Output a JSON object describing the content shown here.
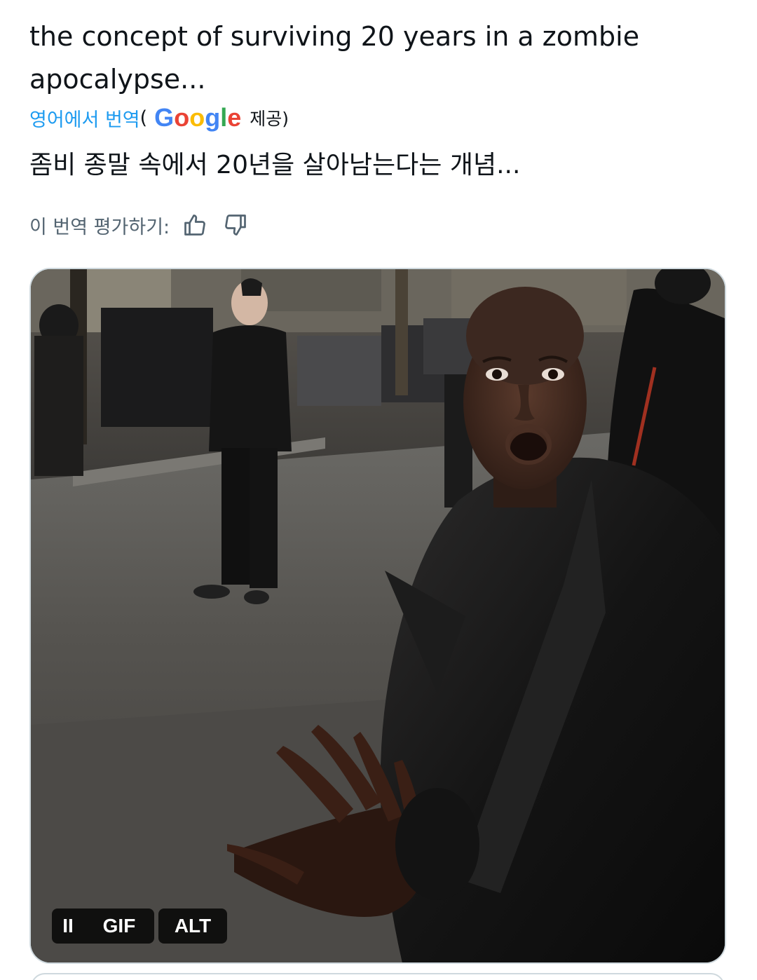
{
  "tweet": {
    "original_text": "the concept of surviving 20 years in a zombie apocalypse...",
    "translation": {
      "source_link": "영어에서 번역",
      "paren_open": "(",
      "google_logo": "Google",
      "provided_by": "제공)",
      "text": "좀비 종말 속에서 20년을 살아남는다는 개념...",
      "rate_label": "이 번역 평가하기:",
      "thumbs_up_icon": "thumbs-up-icon",
      "thumbs_down_icon": "thumbs-down-icon"
    },
    "media": {
      "type": "animated-gif",
      "pause_icon": "pause-icon",
      "pause_label": "II",
      "gif_label": "GIF",
      "alt_label": "ALT"
    }
  },
  "colors": {
    "link": "#1d9bf0",
    "text": "#0f1419",
    "secondary": "#536471",
    "border": "#cfd9de"
  }
}
